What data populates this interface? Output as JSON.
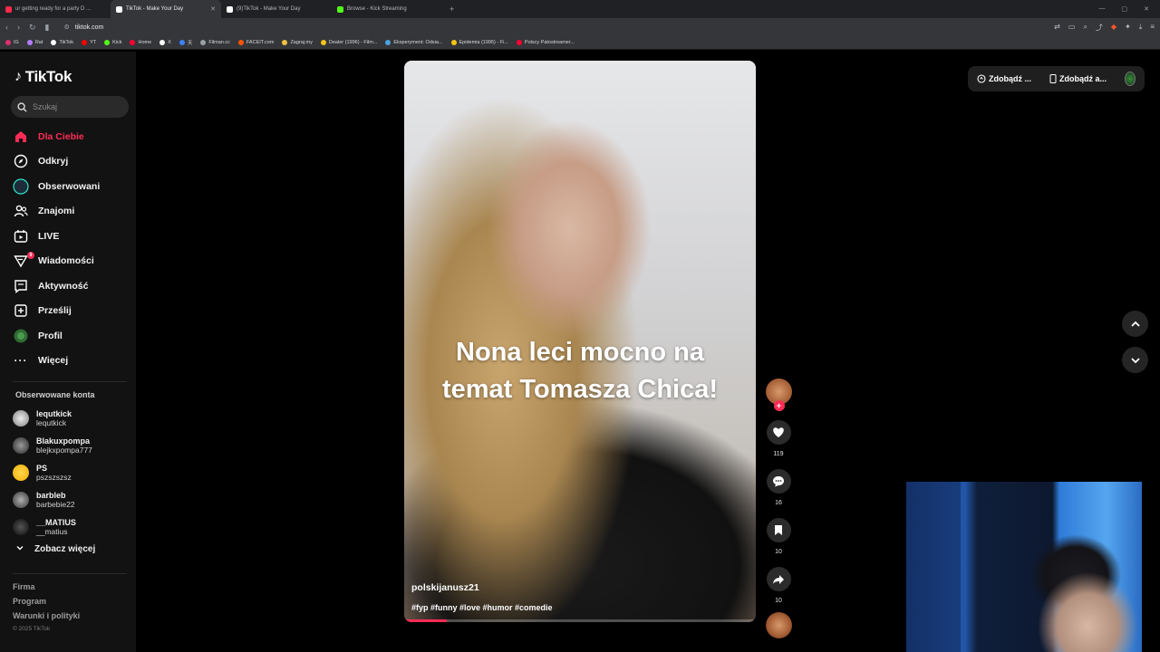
{
  "browser": {
    "tabs": [
      {
        "title": "ur getting ready for a party D ...",
        "color": "#ff2a4a",
        "active": false
      },
      {
        "title": "TikTok - Make Your Day",
        "color": "#ffffff",
        "active": true
      },
      {
        "title": "(9)TikTok - Make Your Day",
        "color": "#ffffff",
        "active": false
      },
      {
        "title": "Browse - Kick Streaming",
        "color": "#53fc18",
        "active": false
      }
    ],
    "url": "tiktok.com",
    "bookmarks": [
      {
        "label": "IG",
        "color": "#e1306c"
      },
      {
        "label": "Rat",
        "color": "#b77cff"
      },
      {
        "label": "TikTok",
        "color": "#ffffff"
      },
      {
        "label": "YT",
        "color": "#ff0000"
      },
      {
        "label": "Kick",
        "color": "#53fc18"
      },
      {
        "label": "Home",
        "color": "#ff0033"
      },
      {
        "label": "X",
        "color": "#ffffff"
      },
      {
        "label": "天",
        "color": "#3b82f6"
      },
      {
        "label": "Filman.cc",
        "color": "#9aa0a6"
      },
      {
        "label": "FACEIT.com",
        "color": "#ff5500"
      },
      {
        "label": "Zagraj.my",
        "color": "#f0c040"
      },
      {
        "label": "Dealer (1996) - Film...",
        "color": "#f5c518"
      },
      {
        "label": "Eksperyment: Odsia...",
        "color": "#4aa3df"
      },
      {
        "label": "Epidemia (1995) - Fi...",
        "color": "#f5c518"
      },
      {
        "label": "Polscy Patostreamer...",
        "color": "#ff0033"
      }
    ]
  },
  "sidebar": {
    "brand": "TikTok",
    "search_placeholder": "Szukaj",
    "nav": [
      {
        "label": "Dla Ciebie",
        "icon": "home-icon",
        "active": true
      },
      {
        "label": "Odkryj",
        "icon": "compass-icon",
        "active": false
      },
      {
        "label": "Obserwowani",
        "icon": "following-avatar-icon",
        "active": false
      },
      {
        "label": "Znajomi",
        "icon": "friends-icon",
        "active": false
      },
      {
        "label": "LIVE",
        "icon": "live-icon",
        "active": false
      },
      {
        "label": "Wiadomości",
        "icon": "messages-icon",
        "active": false,
        "badge": "9"
      },
      {
        "label": "Aktywność",
        "icon": "activity-icon",
        "active": false
      },
      {
        "label": "Prześlij",
        "icon": "upload-icon",
        "active": false
      },
      {
        "label": "Profil",
        "icon": "profile-avatar-icon",
        "active": false
      },
      {
        "label": "Więcej",
        "icon": "more-icon",
        "active": false
      }
    ],
    "following_title": "Obserwowane konta",
    "following": [
      {
        "name": "lequtkick",
        "handle": "lequtkick",
        "color": "#cfcfcf"
      },
      {
        "name": "Blakuxpompa",
        "handle": "blejkxpompa777",
        "color": "#6b6b6b"
      },
      {
        "name": "PS",
        "handle": "pszszszsz",
        "color": "#f5c518"
      },
      {
        "name": "barbleb",
        "handle": "barbebie22",
        "color": "#8a8a8a"
      },
      {
        "name": "__MATIUS",
        "handle": "__matius",
        "color": "#3a3a3a"
      }
    ],
    "see_more": "Zobacz więcej",
    "footer": [
      "Firma",
      "Program",
      "Warunki i polityki"
    ],
    "copyright": "© 2025 TikTok"
  },
  "video": {
    "caption": "Nona leci mocno na temat Tomasza Chica!",
    "author": "polskijanusz21",
    "hashtags": "#fyp #funny #love #humor #comedie",
    "progress": 0.12,
    "likes": "119",
    "comments": "16",
    "saves": "10",
    "shares": "10"
  },
  "topbar": {
    "coins_label": "Zdobądź ...",
    "app_label": "Zdobądź a..."
  }
}
